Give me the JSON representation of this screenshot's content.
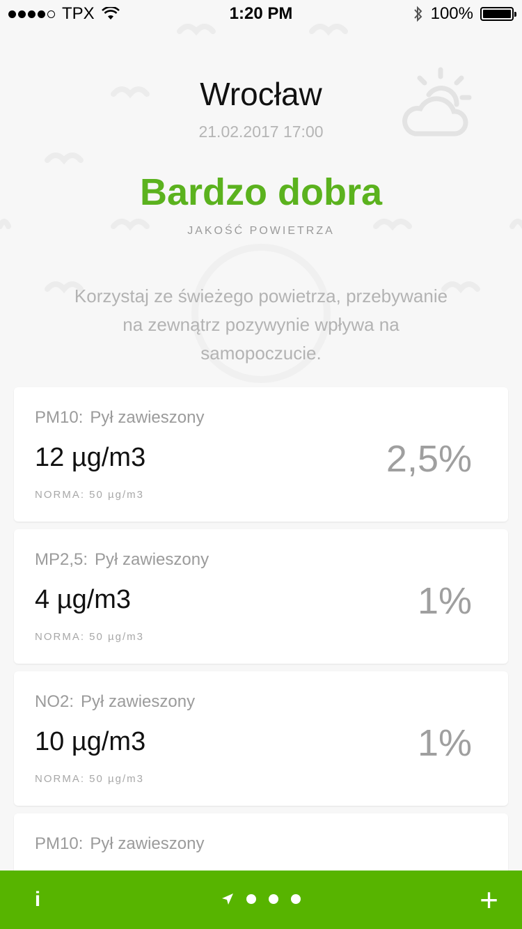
{
  "status_bar": {
    "carrier": "TPX",
    "time": "1:20 PM",
    "battery": "100%"
  },
  "header": {
    "city": "Wrocław",
    "datetime": "21.02.2017 17:00",
    "quality": "Bardzo dobra",
    "quality_label": "JAKOŚĆ POWIETRZA",
    "advice": "Korzystaj ze świeżego powietrza, przebywanie na zewnątrz pozywynie wpływa na samopoczucie."
  },
  "cards": [
    {
      "code": "PM10:",
      "name": "Pył zawieszony",
      "value": "12 µg/m3",
      "norm": "NORMA: 50 µg/m3",
      "percent": "2,5%"
    },
    {
      "code": "MP2,5:",
      "name": "Pył zawieszony",
      "value": "4 µg/m3",
      "norm": "NORMA: 50 µg/m3",
      "percent": "1%"
    },
    {
      "code": "NO2:",
      "name": "Pył zawieszony",
      "value": "10 µg/m3",
      "norm": "NORMA: 50 µg/m3",
      "percent": "1%"
    },
    {
      "code": "PM10:",
      "name": "Pył zawieszony",
      "value": "",
      "norm": "",
      "percent": ""
    }
  ],
  "bottom_bar": {
    "info_label": "i",
    "add_label": "+",
    "pages": [
      "location-arrow-icon",
      "dot",
      "dot",
      "dot"
    ]
  },
  "colors": {
    "accent": "#57b400",
    "quality_text": "#5bb21e",
    "background": "#f7f7f7"
  }
}
